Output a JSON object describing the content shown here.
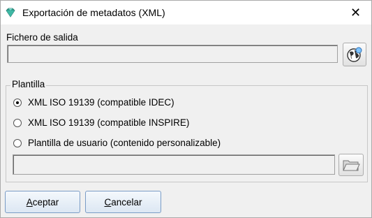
{
  "window": {
    "title": "Exportación de metadatos (XML)"
  },
  "output": {
    "label": "Fichero de salida",
    "value": ""
  },
  "template": {
    "group_label": "Plantilla",
    "options": [
      {
        "label": "XML ISO 19139 (compatible IDEC)",
        "checked": true
      },
      {
        "label": "XML ISO 19139 (compatible INSPIRE)",
        "checked": false
      },
      {
        "label": "Plantilla de usuario (contenido personalizable)",
        "checked": false
      }
    ],
    "user_template_path": ""
  },
  "buttons": {
    "accept": {
      "mnemonic": "A",
      "rest": "ceptar"
    },
    "cancel": {
      "mnemonic": "C",
      "rest": "ancelar"
    }
  },
  "icons": {
    "app": "gem-icon",
    "close": "close-icon",
    "browse_output": "globe-icon",
    "browse_template": "folder-icon"
  },
  "colors": {
    "app_icon": "#2e9a8a",
    "globe": "#333333",
    "folder": "#e8e8e8"
  }
}
